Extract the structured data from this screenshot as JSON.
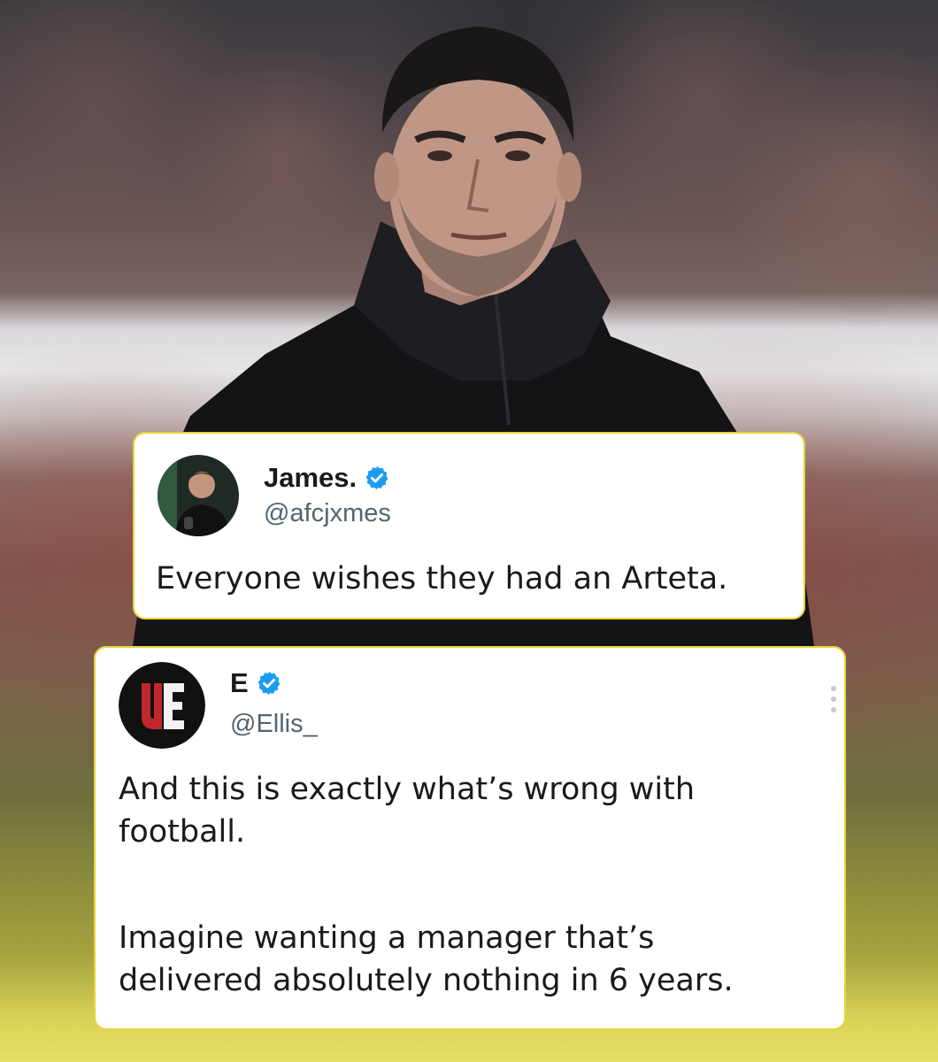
{
  "tweets": [
    {
      "display_name": "James.",
      "handle": "@afcjxmes",
      "verified": true,
      "text_lines": [
        "Everyone wishes they had an Arteta."
      ]
    },
    {
      "display_name": "E",
      "handle": "@Ellis_",
      "verified": true,
      "avatar_logo_text": "UE",
      "paragraphs": [
        [
          "And this is exactly what’s wrong with",
          "football."
        ],
        [
          "Imagine wanting a manager that’s",
          "delivered absolutely nothing in 6 years."
        ]
      ]
    }
  ],
  "colors": {
    "card_border": "#e8d43a",
    "verified_blue": "#1d9bf0",
    "handle_gray": "#536471",
    "logo_red": "#c0282d"
  },
  "icons": [
    "verified-badge-icon",
    "more-options-icon"
  ]
}
